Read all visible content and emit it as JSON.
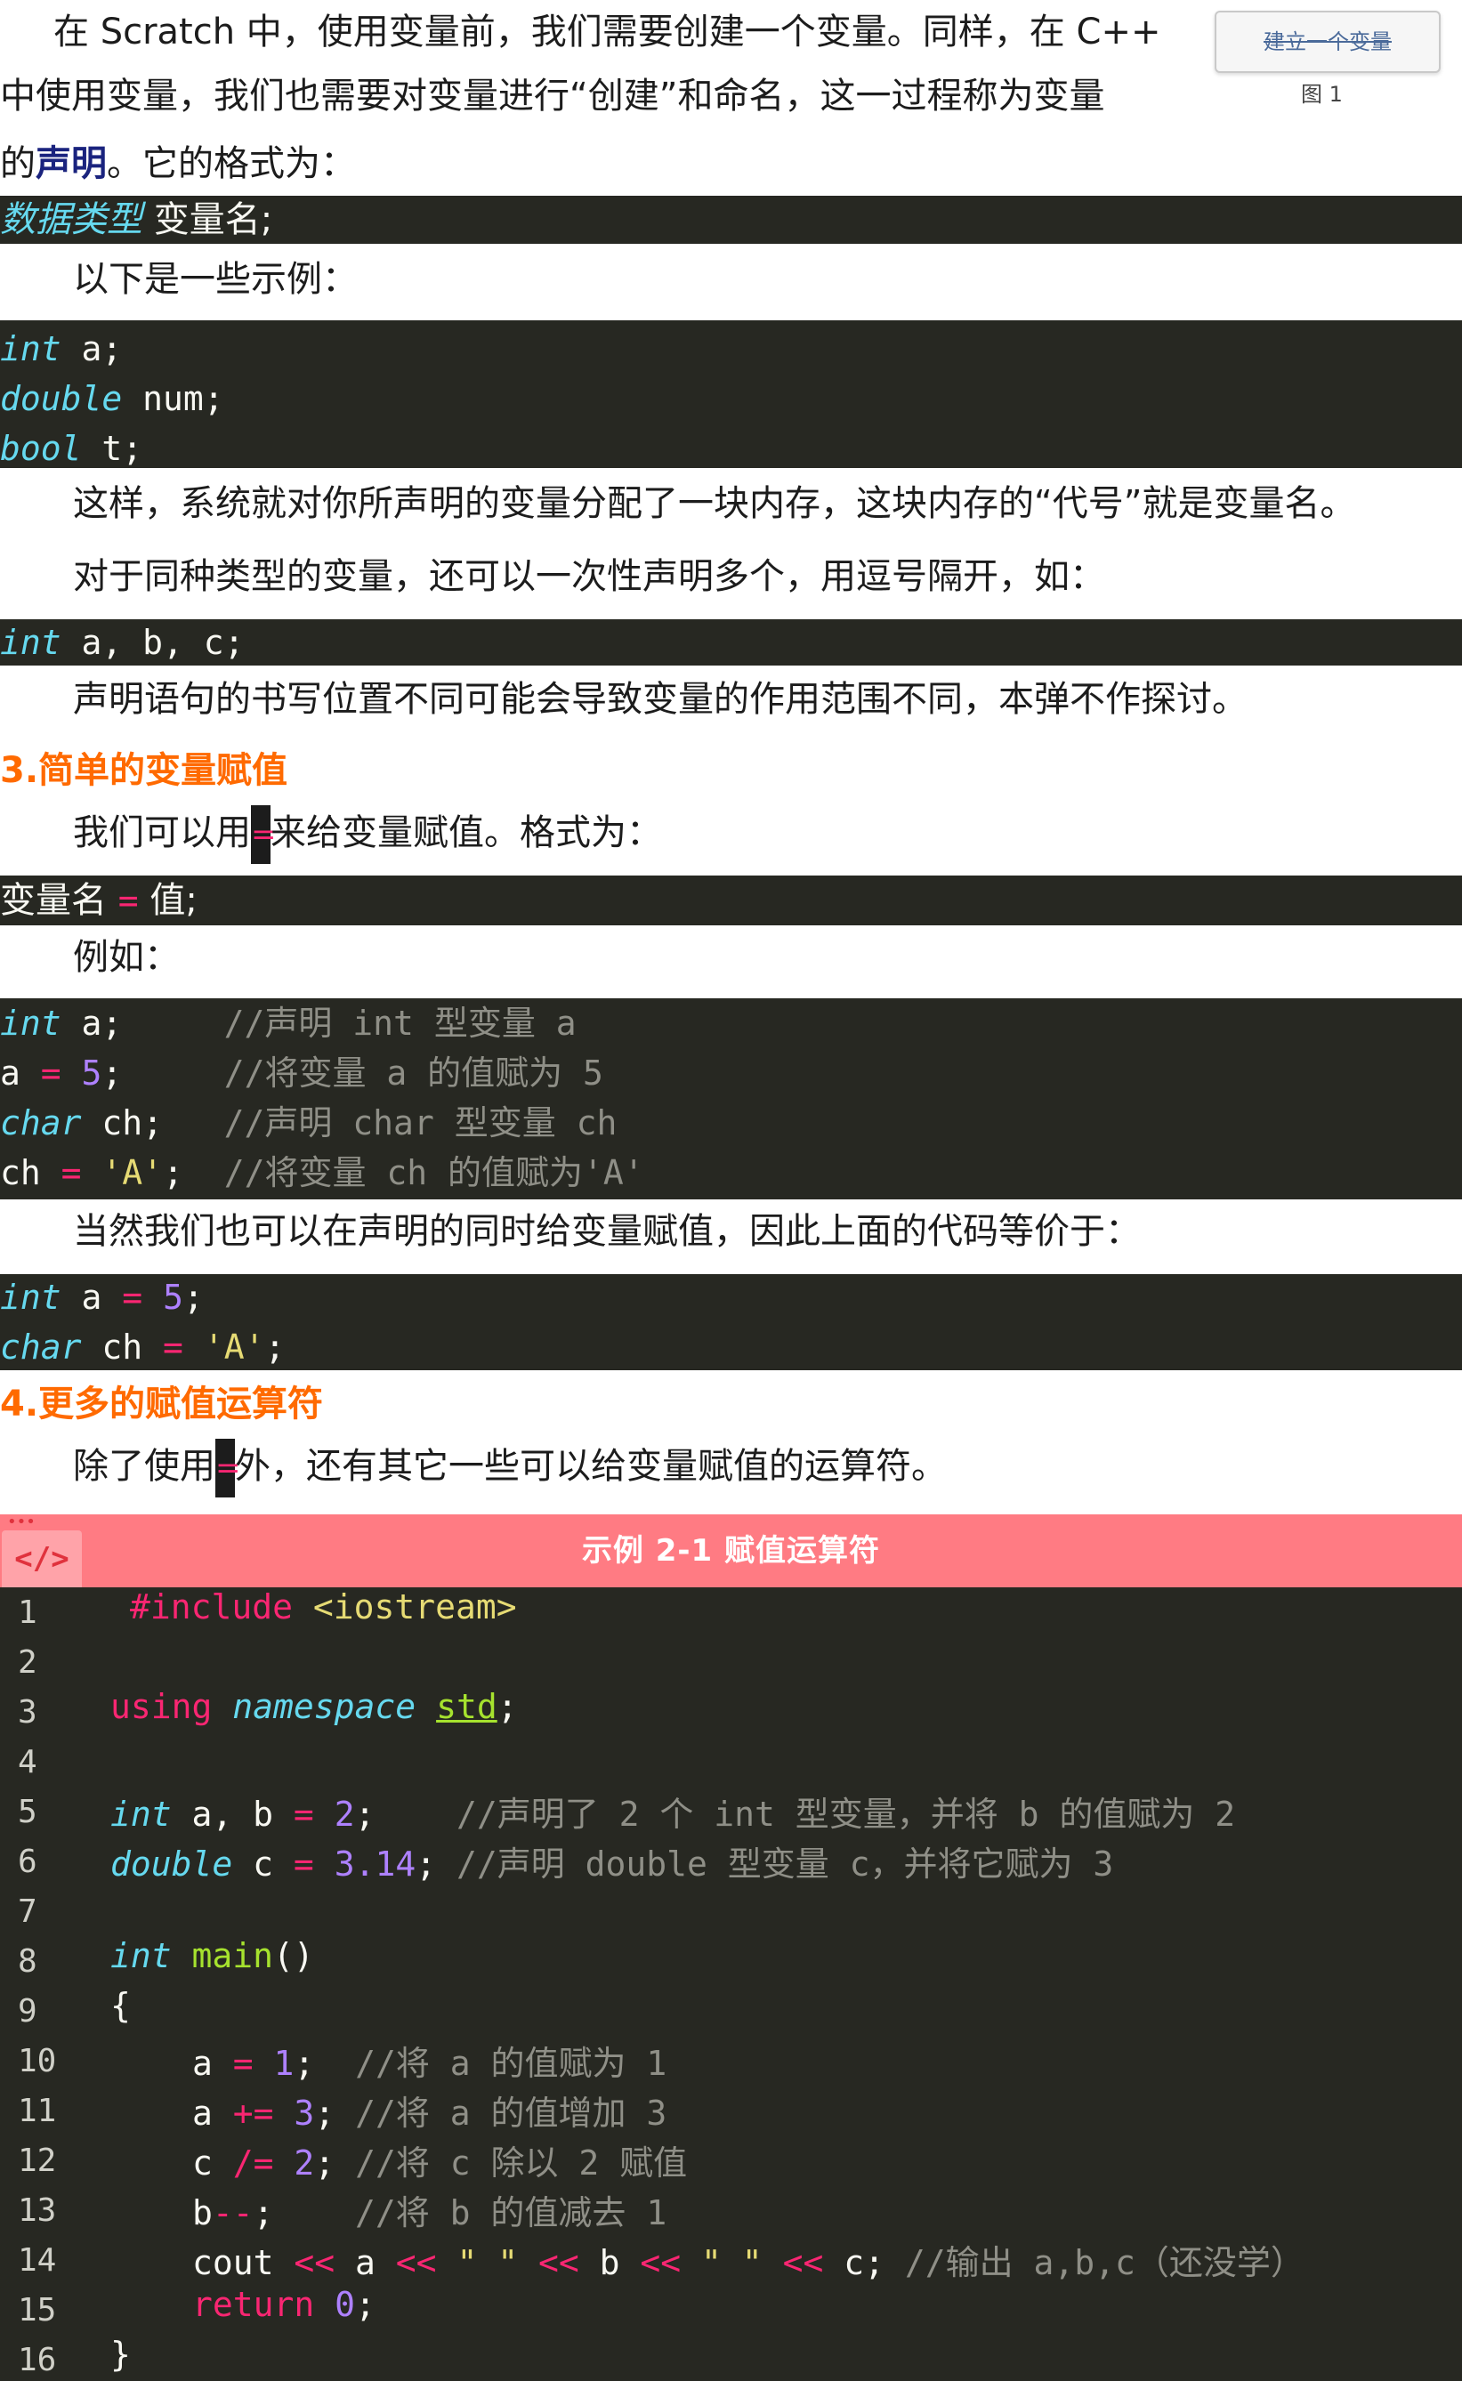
{
  "intro": {
    "line1": "在 Scratch 中，使用变量前，我们需要创建一个变量。同样，在 C++",
    "line2": "中使用变量，我们也需要对变量进行“创建”和命名，这一过程称为变量",
    "line3_pre": "的",
    "line3_strong": "声明",
    "line3_post": "。它的格式为："
  },
  "figure": {
    "button_label": "建立一个变量",
    "caption": "图 1"
  },
  "decl_format": {
    "type": "数据类型",
    "rest": " 变量名;"
  },
  "examples_label": "以下是一些示例：",
  "decl_examples": [
    {
      "type": "int",
      "rest": " a;"
    },
    {
      "type": "double",
      "rest": " num;"
    },
    {
      "type": "bool",
      "rest": " t;"
    }
  ],
  "para_memory": "这样，系统就对你所声明的变量分配了一块内存，这块内存的“代号”就是变量名。",
  "para_multi": "对于同种类型的变量，还可以一次性声明多个，用逗号隔开，如：",
  "multi_decl": {
    "type": "int",
    "rest": " a, b, c;"
  },
  "para_scope": "声明语句的书写位置不同可能会导致变量的作用范围不同，本弹不作探讨。",
  "section3": {
    "heading": "3.简单的变量赋值",
    "para_pre": "我们可以用",
    "op": "=",
    "para_post": "来给变量赋值。格式为：",
    "format": {
      "left": "变量名 ",
      "op": "=",
      "right": " 值;"
    },
    "example_label": "例如：",
    "code": {
      "l1": {
        "type": "int",
        "plain": " a;     ",
        "comment": "//声明 int 型变量 a"
      },
      "l2": {
        "plain1": "a ",
        "op": "=",
        "plain2": " ",
        "num": "5",
        "plain3": ";     ",
        "comment": "//将变量 a 的值赋为 5"
      },
      "l3": {
        "type": "char",
        "plain": " ch;   ",
        "comment": "//声明 char 型变量 ch"
      },
      "l4": {
        "plain1": "ch ",
        "op": "=",
        "plain2": " ",
        "str": "'A'",
        "plain3": ";  ",
        "comment": "//将变量 ch 的值赋为'A'"
      }
    },
    "para_equiv": "当然我们也可以在声明的同时给变量赋值，因此上面的代码等价于：",
    "code2": {
      "l1": {
        "type": "int",
        "plain1": " a ",
        "op": "=",
        "plain2": " ",
        "num": "5",
        "plain3": ";"
      },
      "l2": {
        "type": "char",
        "plain1": " ch ",
        "op": "=",
        "plain2": " ",
        "str": "'A'",
        "plain3": ";"
      }
    }
  },
  "section4": {
    "heading": "4.更多的赋值运算符",
    "para_pre": "除了使用",
    "op": "=",
    "para_post": "外，还有其它一些可以给变量赋值的运算符。"
  },
  "example_box": {
    "icon": "</>",
    "title": "示例 2-1     赋值运算符",
    "line_numbers": [
      "1",
      "2",
      "3",
      "4",
      "5",
      "6",
      "7",
      "8",
      "9",
      "10",
      "11",
      "12",
      "13",
      "14",
      "15",
      "16"
    ],
    "lines": {
      "l1": {
        "pre": "#include ",
        "lib": "<iostream>"
      },
      "l3": {
        "kw": "using",
        "ns": "namespace",
        "std": "std",
        "end": ";"
      },
      "l5": {
        "type": "int",
        "p1": " a, b ",
        "op": "=",
        "p2": " ",
        "num": "2",
        "p3": ";    ",
        "comment": "//声明了 2 个 int 型变量，并将 b 的值赋为 2"
      },
      "l6": {
        "type": "double",
        "p1": " c ",
        "op": "=",
        "p2": " ",
        "num": "3.14",
        "p3": "; ",
        "comment": "//声明 double 型变量 c，并将它赋为 3"
      },
      "l8": {
        "type": "int",
        "fn": "main",
        "p": "()"
      },
      "l9": {
        "p": "{"
      },
      "l10": {
        "p1": "a ",
        "op": "=",
        "p2": " ",
        "num": "1",
        "p3": ";  ",
        "comment": "//将 a 的值赋为 1"
      },
      "l11": {
        "p1": "a ",
        "op": "+=",
        "p2": " ",
        "num": "3",
        "p3": "; ",
        "comment": "//将 a 的值增加 3"
      },
      "l12": {
        "p1": "c ",
        "op": "/=",
        "p2": " ",
        "num": "2",
        "p3": "; ",
        "comment": "//将 c 除以 2 赋值"
      },
      "l13": {
        "p1": "b",
        "op": "--",
        "p3": ";    ",
        "comment": "//将 b 的值减去 1"
      },
      "l14": {
        "p1": "cout ",
        "op1": "<<",
        "p2": " a ",
        "op2": "<<",
        "p3": " ",
        "s1": "\" \"",
        "p4": " ",
        "op3": "<<",
        "p5": " b ",
        "op4": "<<",
        "p6": " ",
        "s2": "\" \"",
        "p7": " ",
        "op5": "<<",
        "p8": " c; ",
        "comment": "//输出 a,b,c（还没学）"
      },
      "l15": {
        "kw": "return",
        "p": " ",
        "num": "0",
        "end": ";"
      },
      "l16": {
        "p": "}"
      }
    }
  },
  "colors": {
    "code_bg": "#272822",
    "keyword_type": "#66d9ef",
    "number": "#ae81ff",
    "operator": "#f92672",
    "string": "#e6db74",
    "comment": "#8f8f87",
    "heading_orange": "#ff6a00",
    "example_header": "#ff7b83"
  }
}
